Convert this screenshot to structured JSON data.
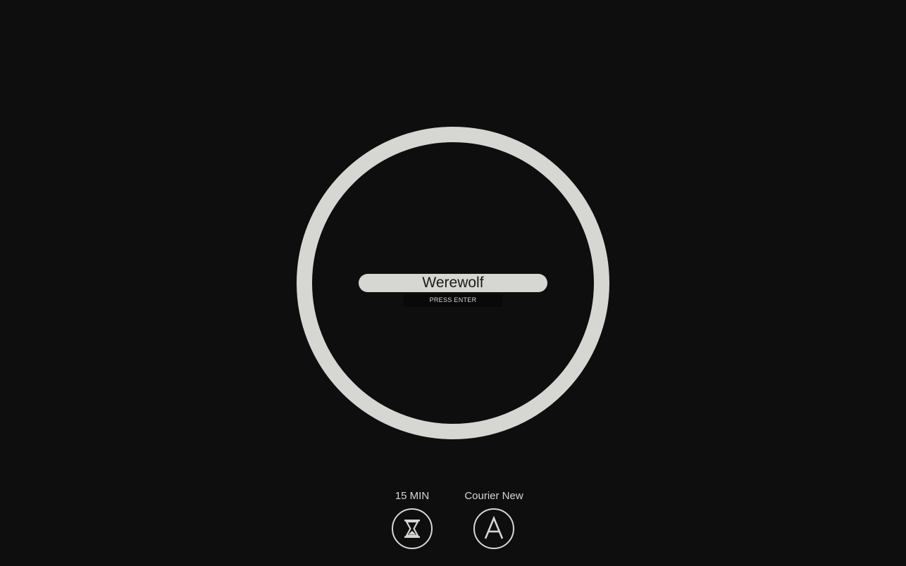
{
  "editor": {
    "title_value": "Werewolf",
    "hint": "PRESS ENTER"
  },
  "controls": {
    "timer_label": "15 MIN",
    "font_label": "Courier New"
  },
  "icons": {
    "timer": "hourglass-icon",
    "font": "letter-a-icon"
  },
  "colors": {
    "background": "#0e0e0e",
    "foreground": "#d6d7d2"
  }
}
